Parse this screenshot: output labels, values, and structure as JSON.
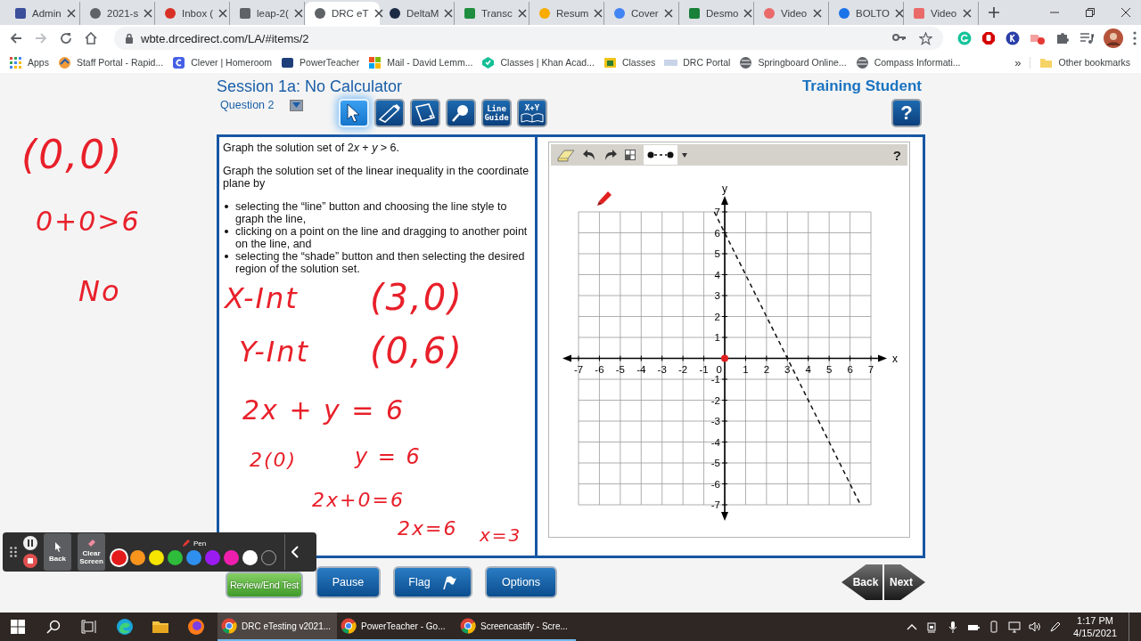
{
  "browser": {
    "tabs": [
      {
        "title": "Admin",
        "selected": false
      },
      {
        "title": "2021-s",
        "selected": false
      },
      {
        "title": "Inbox (",
        "selected": false
      },
      {
        "title": "leap-2(",
        "selected": false
      },
      {
        "title": "DRC eT",
        "selected": true
      },
      {
        "title": "DeltaM",
        "selected": false
      },
      {
        "title": "Transc",
        "selected": false
      },
      {
        "title": "Resum",
        "selected": false
      },
      {
        "title": "Cover",
        "selected": false
      },
      {
        "title": "Desmo",
        "selected": false
      },
      {
        "title": "Video",
        "selected": false
      },
      {
        "title": "BOLTO",
        "selected": false
      },
      {
        "title": "Video",
        "selected": false
      }
    ],
    "address": "wbte.drcedirect.com/LA/#items/2",
    "bookmarks": [
      "Apps",
      "Staff Portal - Rapid...",
      "Clever | Homeroom",
      "PowerTeacher",
      "Mail - David Lemm...",
      "Classes | Khan Acad...",
      "Classes",
      "DRC Portal",
      "Springboard Online...",
      "Compass Informati..."
    ],
    "more_bookmarks": "»",
    "other_bookmarks": "Other bookmarks"
  },
  "test": {
    "session_title": "Session 1a: No Calculator",
    "question": "Question 2",
    "student": "Training Student",
    "help": "?",
    "tools": [
      {
        "kind": "pointer",
        "selected": true
      },
      {
        "kind": "highlighter",
        "selected": false
      },
      {
        "kind": "notepad",
        "selected": false
      },
      {
        "kind": "magnifier",
        "selected": false
      },
      {
        "kind": "line_guide",
        "label": "Line Guide",
        "selected": false
      },
      {
        "kind": "reference",
        "label": "X+Y",
        "selected": false
      }
    ],
    "prompt": [
      {
        "text": "Graph the solution set of 2",
        "italic": false
      },
      {
        "text": "x",
        "italic": true
      },
      {
        "text": " + ",
        "italic": false
      },
      {
        "text": "y",
        "italic": true
      },
      {
        "text": " > 6.",
        "italic": false
      }
    ],
    "instructions": "Graph the solution set of the linear inequality in the coordinate plane by",
    "steps": [
      "selecting the “line” button and choosing the line style to graph the line,",
      "clicking on a point on the line and dragging to another point on the line, and",
      "selecting the “shade” button and then selecting the desired region of the solution set."
    ],
    "graph": {
      "help": "?",
      "chart_data": {
        "type": "line",
        "xlabel": "x",
        "ylabel": "y",
        "x": [
          -0.5,
          6.5
        ],
        "grid": true,
        "series": [
          {
            "color": "#111111",
            "line_style": "dashed",
            "values": [
              7,
              -7
            ]
          }
        ],
        "xlim": [
          -7,
          7
        ],
        "ylim": [
          -7,
          7
        ],
        "xticks": [
          -7,
          -6,
          -5,
          -4,
          -3,
          -2,
          -1,
          0,
          1,
          2,
          3,
          4,
          5,
          6,
          7
        ],
        "yticks": [
          -7,
          -6,
          -5,
          -4,
          -3,
          -2,
          -1,
          1,
          2,
          3,
          4,
          5,
          6,
          7
        ]
      }
    },
    "buttons": [
      {
        "label": "Review/End Test",
        "kind": "review"
      },
      {
        "label": "Pause",
        "kind": "normal"
      },
      {
        "label": "Flag",
        "kind": "flag"
      },
      {
        "label": "Options",
        "kind": "normal"
      }
    ],
    "nav": [
      {
        "label": "Back",
        "kind": "back"
      },
      {
        "label": "Next",
        "kind": "next"
      }
    ]
  },
  "annotations": [
    "(0,0)",
    "0+0>6",
    "No",
    "X-Int",
    "(3,0)",
    "Y-Int",
    "(0,6)",
    "2x + y = 6",
    "2(0)",
    "y = 6",
    "2x+0=6",
    "2x=6",
    "x=3"
  ],
  "recorder": {
    "back": "Back",
    "clear": "Clear Screen",
    "tool": "Pen",
    "colors": [
      {
        "color": "#e41b1b",
        "selected": true
      },
      {
        "color": "#f7941d",
        "selected": false
      },
      {
        "color": "#f4e400",
        "selected": false
      },
      {
        "color": "#2ebd3a",
        "selected": false
      },
      {
        "color": "#2f8fef",
        "selected": false
      },
      {
        "color": "#9b1cf0",
        "selected": false
      },
      {
        "color": "#ef1fae",
        "selected": false
      },
      {
        "color": "#ffffff",
        "selected": false
      },
      {
        "color": "#333333",
        "selected": false
      }
    ]
  },
  "taskbar": {
    "apps": [
      {
        "label": "DRC eTesting v2021...",
        "selected": true
      },
      {
        "label": "PowerTeacher - Go...",
        "selected": false
      },
      {
        "label": "Screencastify - Scre...",
        "selected": false
      }
    ],
    "time": "1:17 PM",
    "date": "4/15/2021"
  }
}
